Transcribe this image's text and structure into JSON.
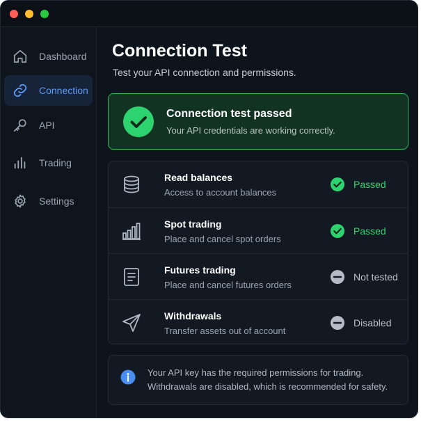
{
  "window": {
    "controls": [
      "close",
      "minimize",
      "maximize"
    ]
  },
  "sidebar": {
    "items": [
      {
        "label": "Dashboard",
        "icon": "home-icon",
        "active": false
      },
      {
        "label": "Connection",
        "icon": "link-icon",
        "active": true
      },
      {
        "label": "API",
        "icon": "key-icon",
        "active": false
      },
      {
        "label": "Trading",
        "icon": "bar-chart-icon",
        "active": false
      },
      {
        "label": "Settings",
        "icon": "gear-icon",
        "active": false
      }
    ]
  },
  "main": {
    "title": "Connection Test",
    "subtitle": "Test your API connection and permissions.",
    "banner": {
      "icon": "check-circle-icon",
      "title": "Connection test passed",
      "description": "Your API credentials are working correctly."
    },
    "permissions": [
      {
        "icon": "database-icon",
        "title": "Read balances",
        "description": "Access to account balances",
        "status": "Passed",
        "status_icon": "check-circle-icon"
      },
      {
        "icon": "bar-chart-icon",
        "title": "Spot trading",
        "description": "Place and cancel spot orders",
        "status": "Passed",
        "status_icon": "check-circle-icon"
      },
      {
        "icon": "document-icon",
        "title": "Futures trading",
        "description": "Place and cancel futures orders",
        "status": "Not tested",
        "status_icon": "minus-circle-icon"
      },
      {
        "icon": "send-icon",
        "title": "Withdrawals",
        "description": "Transfer assets out of account",
        "status": "Disabled",
        "status_icon": "minus-circle-icon"
      }
    ],
    "info": {
      "icon": "info-icon",
      "line1": "Your API key has the required permissions for trading.",
      "line2": "Withdrawals are disabled, which is recommended for safety."
    }
  },
  "colors": {
    "background": "#0e141c",
    "accent": "#5b9cf5",
    "success": "#2dd36f",
    "muted": "#9aa6b4"
  }
}
